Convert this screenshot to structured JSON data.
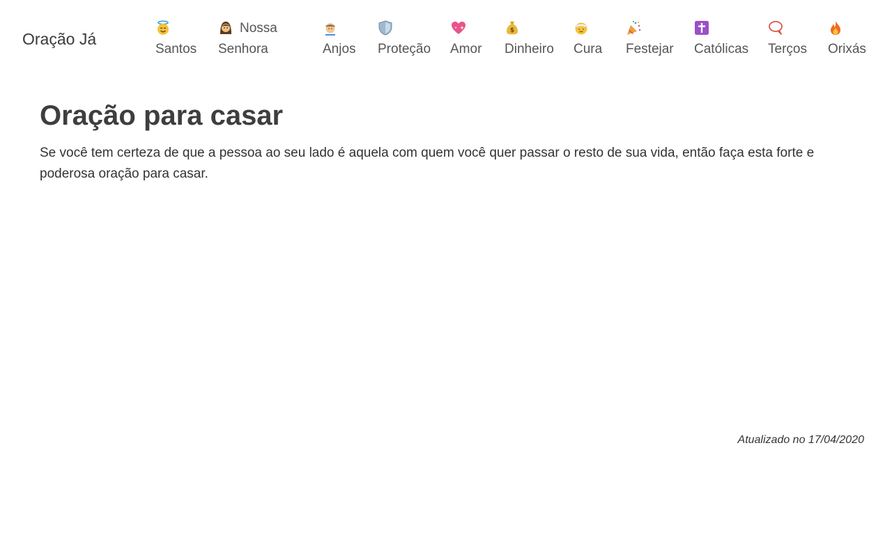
{
  "header": {
    "brand": "Oração Já",
    "nav": [
      {
        "label": "Santos",
        "icon": "smiling-face-with-halo-icon"
      },
      {
        "label_first": "Nossa",
        "label_second": "Senhora",
        "icon": "woman-icon"
      },
      {
        "label": "Anjos",
        "icon": "baby-angel-icon"
      },
      {
        "label": "Proteção",
        "icon": "shield-icon"
      },
      {
        "label": "Amor",
        "icon": "sparkling-heart-icon"
      },
      {
        "label": "Dinheiro",
        "icon": "money-bag-icon"
      },
      {
        "label": "Cura",
        "icon": "face-with-head-bandage-icon"
      },
      {
        "label": "Festejar",
        "icon": "party-popper-icon"
      },
      {
        "label": "Católicas",
        "icon": "latin-cross-icon"
      },
      {
        "label": "Terços",
        "icon": "speech-bubble-icon"
      },
      {
        "label": "Orixás",
        "icon": "fire-icon"
      }
    ]
  },
  "main": {
    "title": "Oração para casar",
    "intro": "Se você tem certeza de que a pessoa ao seu lado é aquela com quem você quer passar o resto de sua vida, então faça esta forte e poderosa oração para casar.",
    "updated": "Atualizado no 17/04/2020"
  },
  "colors": {
    "text": "#333333",
    "nav_text": "#555555",
    "background": "#ffffff"
  }
}
